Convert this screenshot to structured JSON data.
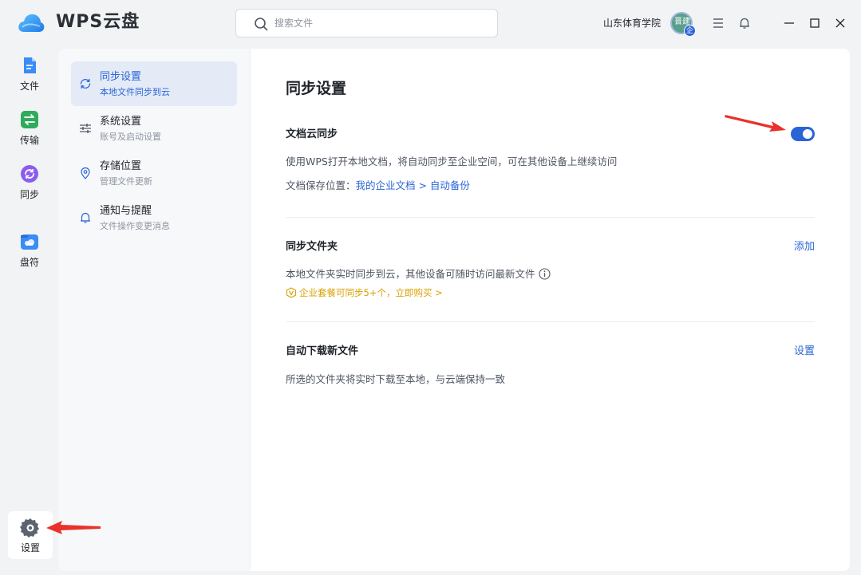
{
  "app": {
    "title": "WPS云盘",
    "search_placeholder": "搜索文件",
    "org_name": "山东体育学院",
    "avatar_text": "晋建",
    "avatar_badge": "企"
  },
  "rail": {
    "items": [
      {
        "label": "文件",
        "icon": "file-icon",
        "color": "#3b8cf5"
      },
      {
        "label": "传输",
        "icon": "transfer-icon",
        "color": "#2eab5b"
      },
      {
        "label": "同步",
        "icon": "sync-icon",
        "color": "#8b5cf0"
      },
      {
        "label": "盘符",
        "icon": "drive-icon",
        "color": "#3b8cf5"
      }
    ],
    "settings_label": "设置"
  },
  "nav": {
    "items": [
      {
        "title": "同步设置",
        "subtitle": "本地文件同步到云",
        "icon": "sync-icon",
        "active": true
      },
      {
        "title": "系统设置",
        "subtitle": "账号及启动设置",
        "icon": "sliders-icon",
        "active": false
      },
      {
        "title": "存储位置",
        "subtitle": "管理文件更新",
        "icon": "location-icon",
        "active": false
      },
      {
        "title": "通知与提醒",
        "subtitle": "文件操作变更消息",
        "icon": "bell-icon",
        "active": false
      }
    ]
  },
  "main": {
    "title": "同步设置",
    "doc_sync": {
      "title": "文档云同步",
      "enabled": true,
      "desc": "使用WPS打开本地文档，将自动同步至企业空间，可在其他设备上继续访问",
      "location_label": "文档保存位置：",
      "location_path": "我的企业文档 > 自动备份"
    },
    "sync_folder": {
      "title": "同步文件夹",
      "action": "添加",
      "desc": "本地文件夹实时同步到云，其他设备可随时访问最新文件",
      "promo": "企业套餐可同步5+个，立即购买 >"
    },
    "auto_download": {
      "title": "自动下载新文件",
      "action": "设置",
      "desc": "所选的文件夹将实时下载至本地，与云端保持一致"
    }
  },
  "colors": {
    "accent": "#2a65d6",
    "promo": "#d8a000",
    "annotation_arrow": "#e8322b"
  }
}
